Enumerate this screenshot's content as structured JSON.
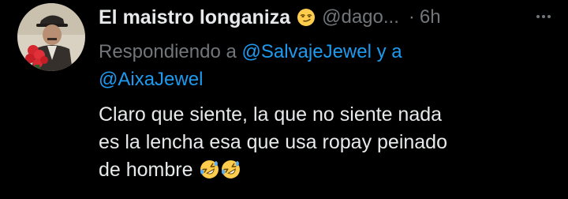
{
  "tweet": {
    "author": {
      "display_name": "El maistro longaniza",
      "name_emoji": "smirking-face",
      "handle": "@dago...",
      "avatar": "profile-photo-man-with-flowers"
    },
    "separator": "·",
    "time": "6h",
    "more_icon": "more-horizontal-icon",
    "reply": {
      "prefix": "Respondiendo a",
      "mention_1": "@SalvajeJewel",
      "conjunction": "y a",
      "mention_2": "@AixaJewel"
    },
    "body": {
      "line_1": "Claro que siente, la que no siente nada",
      "line_2": "es la lencha esa que usa ropay peinado",
      "line_3": "de hombre",
      "trailing_emojis": [
        "rolling-on-floor-laughing",
        "rolling-on-floor-laughing"
      ]
    }
  },
  "colors": {
    "background": "#000000",
    "primary_text": "#e7e9ea",
    "secondary_text": "#71767b",
    "link": "#1d9bf0"
  }
}
